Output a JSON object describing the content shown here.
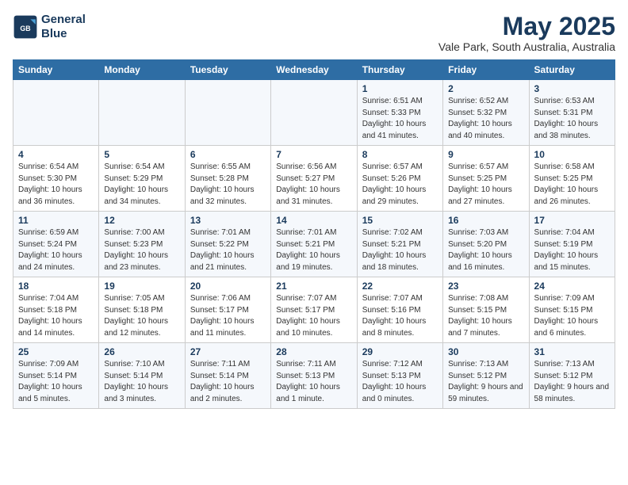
{
  "header": {
    "logo_line1": "General",
    "logo_line2": "Blue",
    "main_title": "May 2025",
    "subtitle": "Vale Park, South Australia, Australia"
  },
  "days_of_week": [
    "Sunday",
    "Monday",
    "Tuesday",
    "Wednesday",
    "Thursday",
    "Friday",
    "Saturday"
  ],
  "weeks": [
    [
      {
        "num": "",
        "sunrise": "",
        "sunset": "",
        "daylight": ""
      },
      {
        "num": "",
        "sunrise": "",
        "sunset": "",
        "daylight": ""
      },
      {
        "num": "",
        "sunrise": "",
        "sunset": "",
        "daylight": ""
      },
      {
        "num": "",
        "sunrise": "",
        "sunset": "",
        "daylight": ""
      },
      {
        "num": "1",
        "sunrise": "6:51 AM",
        "sunset": "5:33 PM",
        "daylight": "10 hours and 41 minutes."
      },
      {
        "num": "2",
        "sunrise": "6:52 AM",
        "sunset": "5:32 PM",
        "daylight": "10 hours and 40 minutes."
      },
      {
        "num": "3",
        "sunrise": "6:53 AM",
        "sunset": "5:31 PM",
        "daylight": "10 hours and 38 minutes."
      }
    ],
    [
      {
        "num": "4",
        "sunrise": "6:54 AM",
        "sunset": "5:30 PM",
        "daylight": "10 hours and 36 minutes."
      },
      {
        "num": "5",
        "sunrise": "6:54 AM",
        "sunset": "5:29 PM",
        "daylight": "10 hours and 34 minutes."
      },
      {
        "num": "6",
        "sunrise": "6:55 AM",
        "sunset": "5:28 PM",
        "daylight": "10 hours and 32 minutes."
      },
      {
        "num": "7",
        "sunrise": "6:56 AM",
        "sunset": "5:27 PM",
        "daylight": "10 hours and 31 minutes."
      },
      {
        "num": "8",
        "sunrise": "6:57 AM",
        "sunset": "5:26 PM",
        "daylight": "10 hours and 29 minutes."
      },
      {
        "num": "9",
        "sunrise": "6:57 AM",
        "sunset": "5:25 PM",
        "daylight": "10 hours and 27 minutes."
      },
      {
        "num": "10",
        "sunrise": "6:58 AM",
        "sunset": "5:25 PM",
        "daylight": "10 hours and 26 minutes."
      }
    ],
    [
      {
        "num": "11",
        "sunrise": "6:59 AM",
        "sunset": "5:24 PM",
        "daylight": "10 hours and 24 minutes."
      },
      {
        "num": "12",
        "sunrise": "7:00 AM",
        "sunset": "5:23 PM",
        "daylight": "10 hours and 23 minutes."
      },
      {
        "num": "13",
        "sunrise": "7:01 AM",
        "sunset": "5:22 PM",
        "daylight": "10 hours and 21 minutes."
      },
      {
        "num": "14",
        "sunrise": "7:01 AM",
        "sunset": "5:21 PM",
        "daylight": "10 hours and 19 minutes."
      },
      {
        "num": "15",
        "sunrise": "7:02 AM",
        "sunset": "5:21 PM",
        "daylight": "10 hours and 18 minutes."
      },
      {
        "num": "16",
        "sunrise": "7:03 AM",
        "sunset": "5:20 PM",
        "daylight": "10 hours and 16 minutes."
      },
      {
        "num": "17",
        "sunrise": "7:04 AM",
        "sunset": "5:19 PM",
        "daylight": "10 hours and 15 minutes."
      }
    ],
    [
      {
        "num": "18",
        "sunrise": "7:04 AM",
        "sunset": "5:18 PM",
        "daylight": "10 hours and 14 minutes."
      },
      {
        "num": "19",
        "sunrise": "7:05 AM",
        "sunset": "5:18 PM",
        "daylight": "10 hours and 12 minutes."
      },
      {
        "num": "20",
        "sunrise": "7:06 AM",
        "sunset": "5:17 PM",
        "daylight": "10 hours and 11 minutes."
      },
      {
        "num": "21",
        "sunrise": "7:07 AM",
        "sunset": "5:17 PM",
        "daylight": "10 hours and 10 minutes."
      },
      {
        "num": "22",
        "sunrise": "7:07 AM",
        "sunset": "5:16 PM",
        "daylight": "10 hours and 8 minutes."
      },
      {
        "num": "23",
        "sunrise": "7:08 AM",
        "sunset": "5:15 PM",
        "daylight": "10 hours and 7 minutes."
      },
      {
        "num": "24",
        "sunrise": "7:09 AM",
        "sunset": "5:15 PM",
        "daylight": "10 hours and 6 minutes."
      }
    ],
    [
      {
        "num": "25",
        "sunrise": "7:09 AM",
        "sunset": "5:14 PM",
        "daylight": "10 hours and 5 minutes."
      },
      {
        "num": "26",
        "sunrise": "7:10 AM",
        "sunset": "5:14 PM",
        "daylight": "10 hours and 3 minutes."
      },
      {
        "num": "27",
        "sunrise": "7:11 AM",
        "sunset": "5:14 PM",
        "daylight": "10 hours and 2 minutes."
      },
      {
        "num": "28",
        "sunrise": "7:11 AM",
        "sunset": "5:13 PM",
        "daylight": "10 hours and 1 minute."
      },
      {
        "num": "29",
        "sunrise": "7:12 AM",
        "sunset": "5:13 PM",
        "daylight": "10 hours and 0 minutes."
      },
      {
        "num": "30",
        "sunrise": "7:13 AM",
        "sunset": "5:12 PM",
        "daylight": "9 hours and 59 minutes."
      },
      {
        "num": "31",
        "sunrise": "7:13 AM",
        "sunset": "5:12 PM",
        "daylight": "9 hours and 58 minutes."
      }
    ]
  ]
}
